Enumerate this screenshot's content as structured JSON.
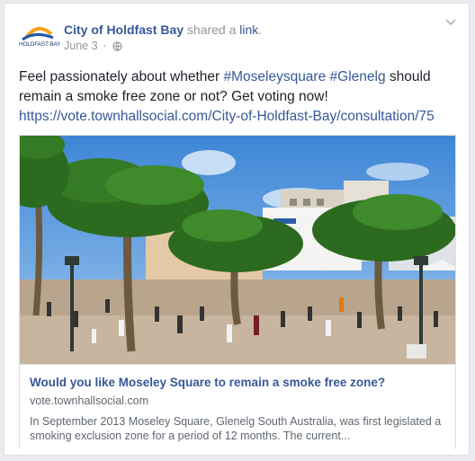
{
  "post": {
    "author": "City of Holdfast Bay",
    "action": " shared a ",
    "action_link": "link",
    "action_end": ".",
    "date": "June 3",
    "logo_text": "HOLDFAST BAY",
    "privacy_icon": "globe-icon",
    "menu_icon": "chevron-down-icon",
    "text_before": "Feel passionately about whether ",
    "hashtag1": "#Moseleysquare",
    "hashtag2": "#Glenelg",
    "text_after": " should remain a smoke free zone or not? Get voting now!",
    "url": "https://vote.townhallsocial.com/City-of-Holdfast-Bay/consultation/75"
  },
  "attachment": {
    "title": "Would you like Moseley Square to remain a smoke free zone?",
    "domain": "vote.townhallsocial.com",
    "description": "In September 2013 Moseley Square, Glenelg South Australia, was first legislated a smoking exclusion zone for a period of 12 months. The current..."
  },
  "colors": {
    "link": "#365899",
    "text": "#1d2129",
    "muted": "#90949c",
    "border": "#dddfe2"
  }
}
